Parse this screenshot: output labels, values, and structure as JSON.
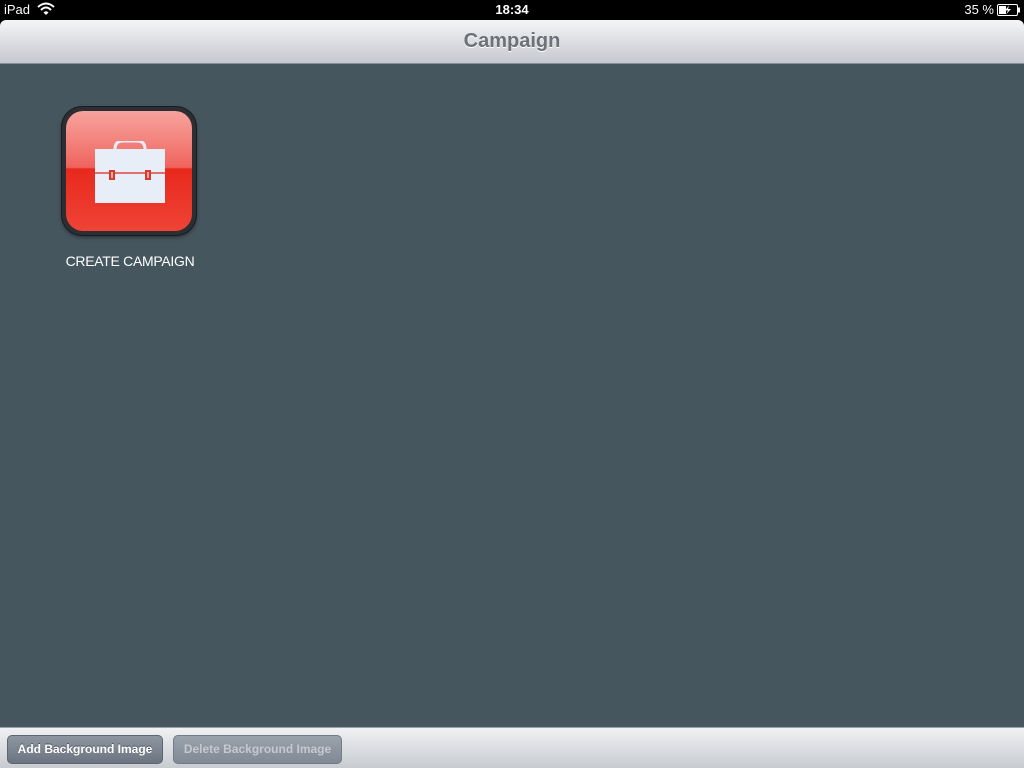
{
  "status_bar": {
    "device": "iPad",
    "time": "18:34",
    "battery_percent": "35 %",
    "wifi_icon": "wifi-icon",
    "battery_icon": "battery-charging-icon"
  },
  "navbar": {
    "title": "Campaign"
  },
  "main": {
    "tiles": [
      {
        "label": "CREATE CAMPAIGN",
        "icon": "briefcase-icon",
        "color": "#e8281d"
      }
    ],
    "background_color": "#46565f"
  },
  "toolbar": {
    "add_label": "Add Background Image",
    "delete_label": "Delete Background Image"
  }
}
